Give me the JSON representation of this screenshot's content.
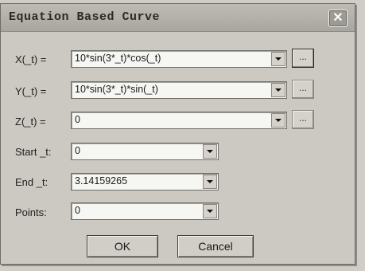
{
  "dialog": {
    "title": "Equation Based Curve",
    "close_glyph": "✕"
  },
  "fields": [
    {
      "label": "X(_t) =",
      "value": "10*sin(3*_t)*cos(_t)",
      "has_dots": true
    },
    {
      "label": "Y(_t) =",
      "value": "10*sin(3*_t)*sin(_t)",
      "has_dots": true
    },
    {
      "label": "Z(_t) =",
      "value": "0",
      "has_dots": true
    },
    {
      "label": "Start _t:",
      "value": "0",
      "has_dots": false
    },
    {
      "label": "End _t:",
      "value": "3.14159265",
      "has_dots": false
    },
    {
      "label": "Points:",
      "value": "0",
      "has_dots": false
    }
  ],
  "buttons": {
    "ok": "OK",
    "cancel": "Cancel",
    "dots": "..."
  },
  "icons": {
    "close": "close-icon",
    "dropdown": "chevron-down-icon"
  }
}
